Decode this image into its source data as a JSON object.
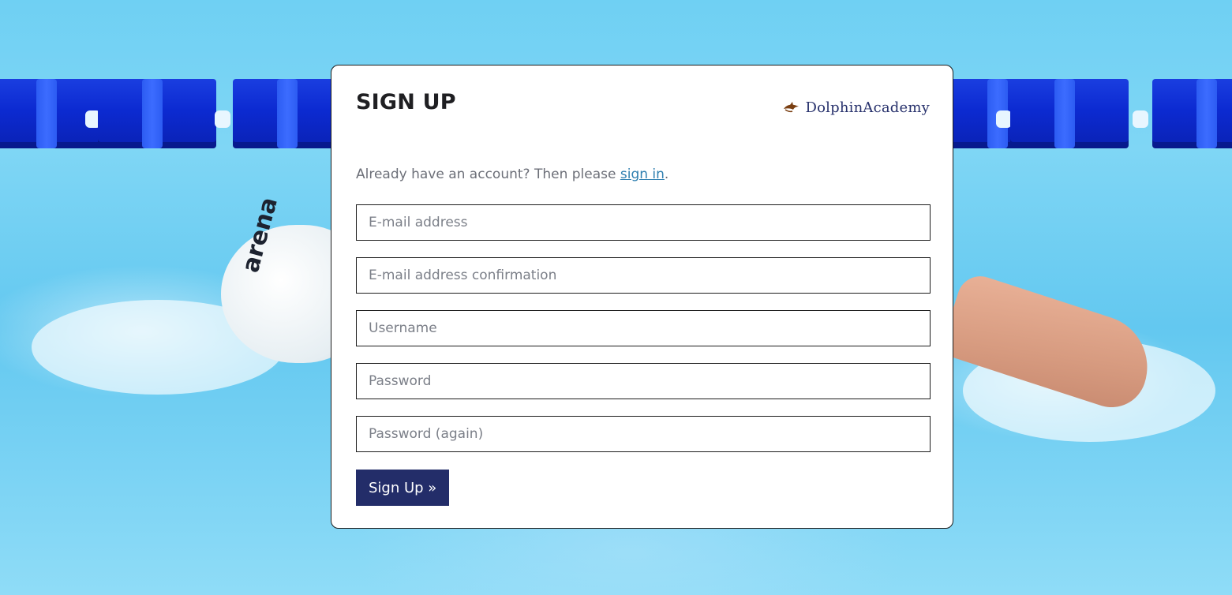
{
  "form": {
    "title": "SIGN UP",
    "brand_name": "DolphinAcademy",
    "signin_prompt": "Already have an account? Then please ",
    "signin_link": "sign in",
    "signin_suffix": ".",
    "email_placeholder": "E-mail address",
    "email_confirm_placeholder": "E-mail address confirmation",
    "username_placeholder": "Username",
    "password_placeholder": "Password",
    "password_again_placeholder": "Password (again)",
    "submit_label": "Sign Up »"
  },
  "background": {
    "cap_text": "arena"
  },
  "colors": {
    "brand": "#27316c",
    "button": "#232d69",
    "link": "#2f7fb0"
  },
  "icons": {
    "brand_logo": "dolphin-icon"
  }
}
